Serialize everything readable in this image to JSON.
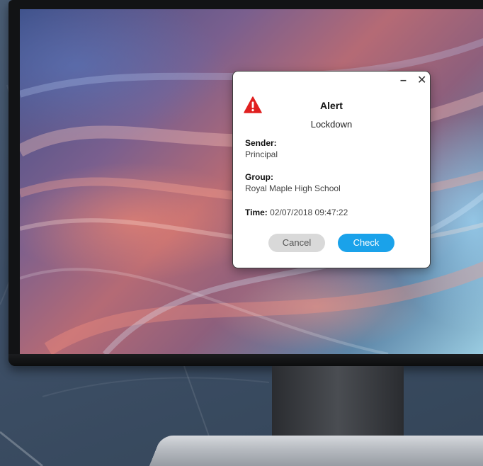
{
  "dialog": {
    "title": "Alert",
    "subtitle": "Lockdown",
    "sender_label": "Sender:",
    "sender_value": "Principal",
    "group_label": "Group:",
    "group_value": "Royal Maple High School",
    "time_label": "Time:",
    "time_value": "02/07/2018 09:47:22",
    "minimize_glyph": "–",
    "close_glyph": "✕",
    "cancel_label": "Cancel",
    "check_label": "Check"
  },
  "icons": [
    "warning-icon",
    "minimize-icon",
    "close-icon"
  ],
  "colors": {
    "alert_red": "#e02020",
    "check_button": "#1aa2ea",
    "cancel_button": "#d9d9d9",
    "backdrop": "#3e5068"
  }
}
